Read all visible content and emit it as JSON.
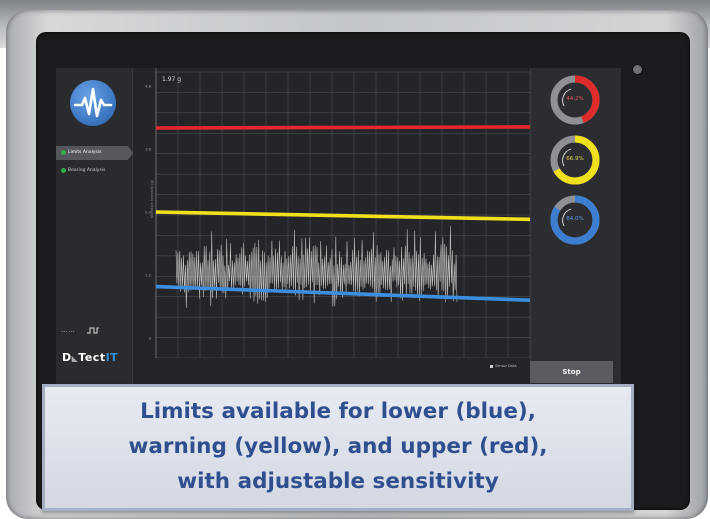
{
  "app": {
    "brand_prefix": "D",
    "brand_middle": "Tect",
    "brand_suffix": "IT"
  },
  "sidebar": {
    "items": [
      {
        "label": "Limits Analysis",
        "active": true
      },
      {
        "label": "Bearing Analysis",
        "active": false
      }
    ],
    "footer_text": "••• ••• "
  },
  "chart": {
    "readout": "1.97 g",
    "y_axis_label": "Vibration Intensity (g)"
  },
  "chart_data": {
    "type": "line",
    "title": "",
    "ylim": [
      0,
      4.8
    ],
    "yticks": [
      0,
      1.2,
      2.4,
      3.6,
      4.8
    ],
    "series": [
      {
        "name": "upper",
        "color": "#e8262e",
        "start": 4.0,
        "end": 4.02
      },
      {
        "name": "warning",
        "color": "#f1e11c",
        "start": 2.4,
        "end": 2.26
      },
      {
        "name": "lower",
        "color": "#3c8fe0",
        "start": 0.98,
        "end": 0.72
      }
    ],
    "signal": {
      "baseline": 1.2,
      "amplitude_min": 0.35,
      "amplitude_max": 0.95,
      "points": 300,
      "color": "#c9c9c9"
    },
    "grid": true
  },
  "gauges": [
    {
      "value": "44.2%",
      "fraction": 0.442,
      "color": "#e02b2b",
      "text_color": "#e25555"
    },
    {
      "value": "66.9%",
      "fraction": 0.669,
      "color": "#f1e11c",
      "text_color": "#e8d84c"
    },
    {
      "value": "84.0%",
      "fraction": 0.84,
      "color": "#3c7fd0",
      "text_color": "#5a9ae8"
    }
  ],
  "controls": {
    "sensor_toggle_label": "Sensor Data",
    "stop_label": "Stop"
  },
  "caption": {
    "line1": "Limits available for lower (blue),",
    "line2": "warning (yellow), and upper (red),",
    "line3": "with adjustable sensitivity"
  }
}
